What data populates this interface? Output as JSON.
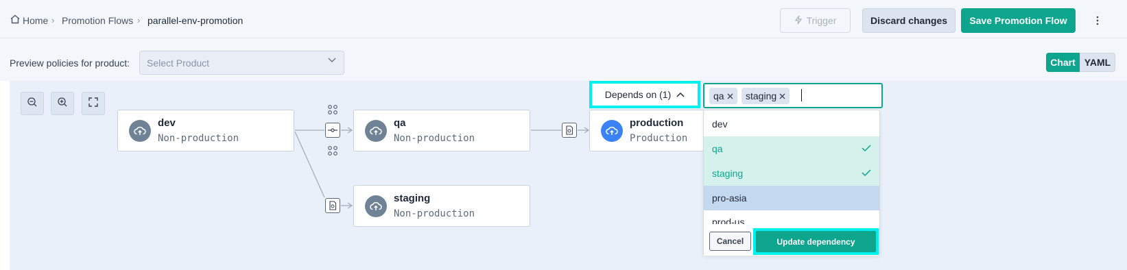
{
  "breadcrumb": {
    "home": "Home",
    "flows": "Promotion Flows",
    "current": "parallel-env-promotion"
  },
  "toolbar": {
    "trigger_label": "Trigger",
    "discard_label": "Discard changes",
    "save_label": "Save Promotion Flow"
  },
  "preview": {
    "label": "Preview policies for product:",
    "select_placeholder": "Select Product"
  },
  "view_toggle": {
    "chart": "Chart",
    "yaml": "YAML",
    "active": "Chart"
  },
  "nodes": {
    "dev": {
      "title": "dev",
      "subtitle": "Non-production"
    },
    "qa": {
      "title": "qa",
      "subtitle": "Non-production"
    },
    "staging": {
      "title": "staging",
      "subtitle": "Non-production"
    },
    "production": {
      "title": "production",
      "subtitle": "Production"
    }
  },
  "dependency": {
    "button_label": "Depends on (1)",
    "selected_tags": [
      "qa",
      "staging"
    ],
    "options": [
      {
        "label": "dev",
        "state": "normal"
      },
      {
        "label": "qa",
        "state": "selected"
      },
      {
        "label": "staging",
        "state": "selected"
      },
      {
        "label": "pro-asia",
        "state": "hover"
      },
      {
        "label": "prod-us",
        "state": "normal"
      }
    ],
    "cancel_label": "Cancel",
    "update_label": "Update dependency"
  },
  "colors": {
    "accent": "#0ea58f",
    "highlight": "#00f0f0",
    "node_icon": "#6f8296",
    "production_icon": "#3b82f6"
  }
}
